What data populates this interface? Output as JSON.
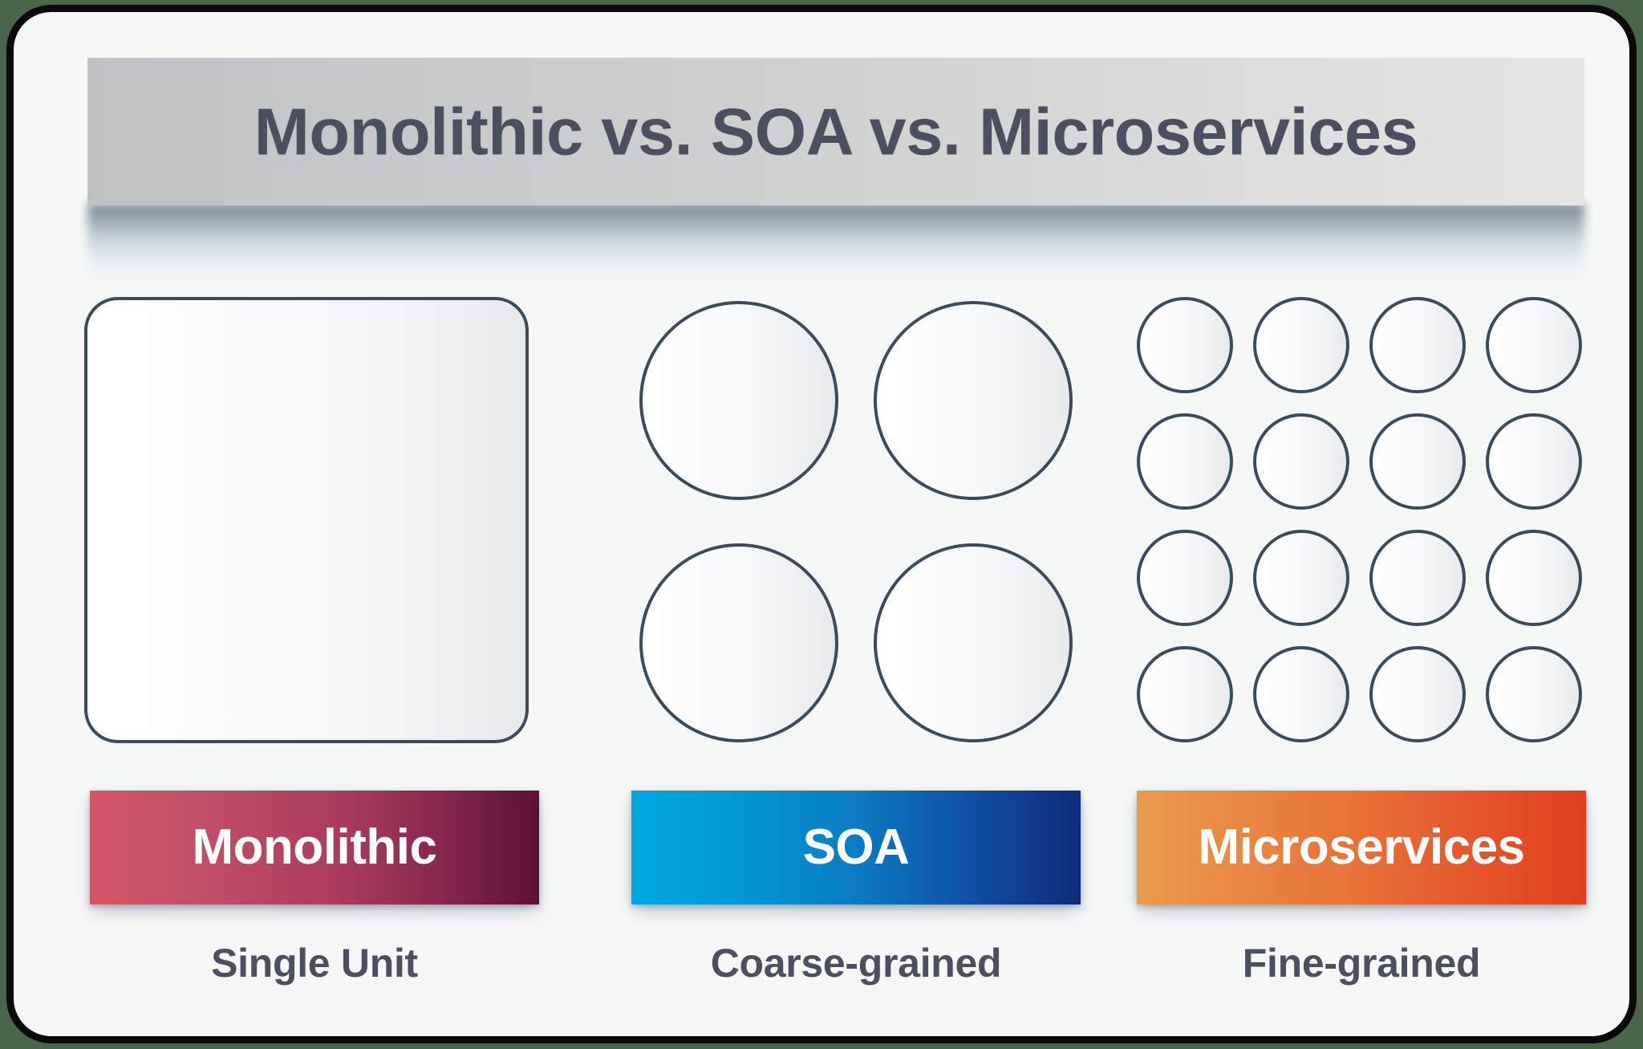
{
  "title": {
    "text": "Monolithic vs. SOA vs. Microservices",
    "text_color": "#4b4f60",
    "band_gradient_from": "#bfc2c4",
    "band_gradient_to": "#e4e5e3"
  },
  "canvas": {
    "background": "#4a664a",
    "card_background": "#f6f8f8",
    "card_border_color": "#0a0a0a"
  },
  "shape_style": {
    "stroke": "#3a4b5c",
    "fill_from": "#ffffff",
    "fill_to": "#e7e9ed"
  },
  "columns": [
    {
      "id": "monolithic",
      "label": "Monolithic",
      "caption": "Single Unit",
      "shape": "single-rounded-square",
      "unit_count": 1,
      "grid": {
        "rows": 1,
        "cols": 1
      },
      "bar_gradient_from": "#d35667",
      "bar_gradient_to": "#5e1037"
    },
    {
      "id": "soa",
      "label": "SOA",
      "caption": "Coarse-grained",
      "shape": "circles",
      "unit_count": 4,
      "grid": {
        "rows": 2,
        "cols": 2
      },
      "bar_gradient_from": "#00a7e0",
      "bar_gradient_to": "#102a79"
    },
    {
      "id": "microservices",
      "label": "Microservices",
      "caption": "Fine-grained",
      "shape": "circles",
      "unit_count": 16,
      "grid": {
        "rows": 4,
        "cols": 4
      },
      "bar_gradient_from": "#ea9a4d",
      "bar_gradient_to": "#e03e1d"
    }
  ]
}
